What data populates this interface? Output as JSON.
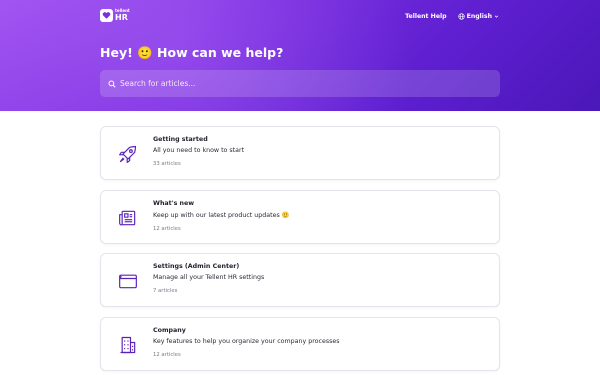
{
  "header": {
    "logo_brand": "tellent",
    "logo_product": "HR",
    "help_link": "Tellent Help",
    "language": "English",
    "headline": "Hey! 🙂 How can we help?",
    "search_placeholder": "Search for articles..."
  },
  "colors": {
    "hero_gradient": [
      "#a052f0",
      "#5e1fd0",
      "#4a17b8"
    ],
    "accent": "#5b22b8"
  },
  "collections": [
    {
      "title": "Getting started",
      "description": "All you need to know to start",
      "count": "33 articles",
      "icon": "rocket-icon"
    },
    {
      "title": "What's new",
      "description": "Keep up with our latest product updates 🙂",
      "count": "12 articles",
      "icon": "newspaper-icon"
    },
    {
      "title": "Settings (Admin Center)",
      "description": "Manage all your Tellent HR settings",
      "count": "7 articles",
      "icon": "browser-window-icon"
    },
    {
      "title": "Company",
      "description": "Key features to help you organize your company processes",
      "count": "12 articles",
      "icon": "building-icon"
    }
  ]
}
